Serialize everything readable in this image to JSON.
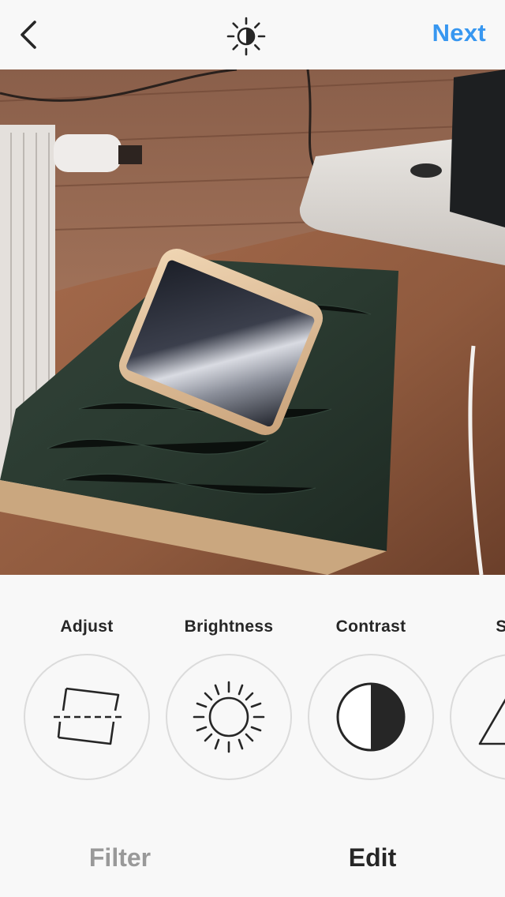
{
  "header": {
    "back_icon": "chevron-left-icon",
    "lux_icon": "lux-sun-half-icon",
    "next_label": "Next",
    "accent_color": "#3897f0"
  },
  "photo": {
    "content": "photo-preview"
  },
  "tools": [
    {
      "label": "Adjust",
      "icon": "adjust-icon"
    },
    {
      "label": "Brightness",
      "icon": "brightness-icon"
    },
    {
      "label": "Contrast",
      "icon": "contrast-icon"
    },
    {
      "label": "Stru",
      "icon": "structure-icon"
    }
  ],
  "tabs": {
    "filter_label": "Filter",
    "edit_label": "Edit",
    "active": "Edit"
  }
}
